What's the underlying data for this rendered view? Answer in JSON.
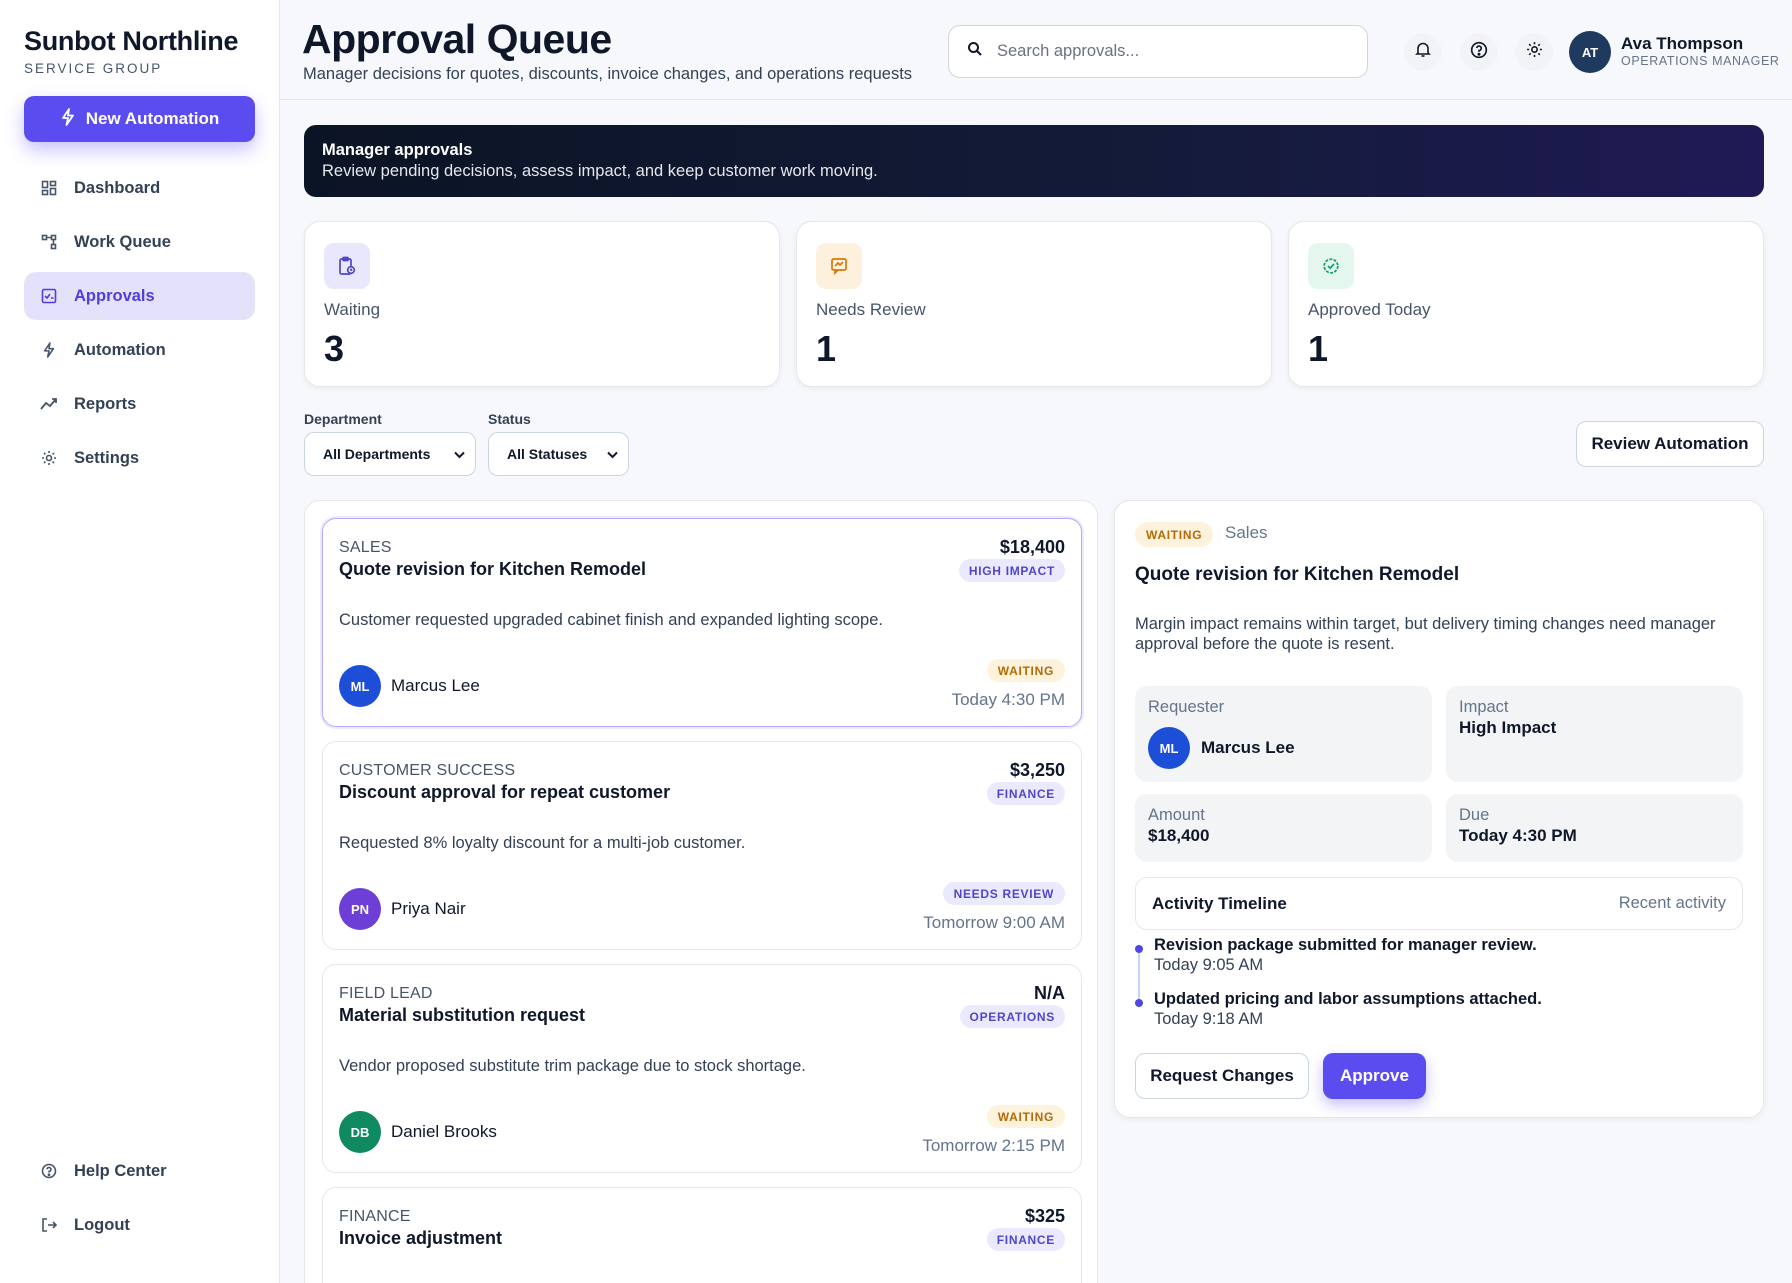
{
  "brand": {
    "name": "Sunbot Northline",
    "sub": "SERVICE GROUP"
  },
  "sidebar": {
    "new_automation": "New Automation",
    "items": [
      {
        "label": "Dashboard",
        "icon": "dashboard-icon"
      },
      {
        "label": "Work Queue",
        "icon": "work-queue-icon"
      },
      {
        "label": "Approvals",
        "icon": "approvals-icon",
        "active": true
      },
      {
        "label": "Automation",
        "icon": "bolt-icon"
      },
      {
        "label": "Reports",
        "icon": "trend-icon"
      },
      {
        "label": "Settings",
        "icon": "gear-icon"
      }
    ],
    "bottom": [
      {
        "label": "Help Center",
        "icon": "help-icon"
      },
      {
        "label": "Logout",
        "icon": "logout-icon"
      }
    ]
  },
  "header": {
    "title": "Approval Queue",
    "subtitle": "Manager decisions for quotes, discounts, invoice changes, and operations requests",
    "search_placeholder": "Search approvals...",
    "user": {
      "initials": "AT",
      "name": "Ava Thompson",
      "role": "OPERATIONS MANAGER"
    }
  },
  "banner": {
    "title": "Manager approvals",
    "text": "Review pending decisions, assess impact, and keep customer work moving."
  },
  "stats": [
    {
      "label": "Waiting",
      "value": "3"
    },
    {
      "label": "Needs Review",
      "value": "1"
    },
    {
      "label": "Approved Today",
      "value": "1"
    }
  ],
  "filters": {
    "department_label": "Department",
    "department_value": "All Departments",
    "status_label": "Status",
    "status_value": "All Statuses",
    "review_automation": "Review Automation"
  },
  "approvals": [
    {
      "dept": "SALES",
      "title": "Quote revision for Kitchen Remodel",
      "amount": "$18,400",
      "tag": "HIGH IMPACT",
      "desc": "Customer requested upgraded cabinet finish and expanded lighting scope.",
      "initials": "ML",
      "person": "Marcus Lee",
      "status": "WAITING",
      "time": "Today 4:30 PM"
    },
    {
      "dept": "CUSTOMER SUCCESS",
      "title": "Discount approval for repeat customer",
      "amount": "$3,250",
      "tag": "FINANCE",
      "desc": "Requested 8% loyalty discount for a multi-job customer.",
      "initials": "PN",
      "person": "Priya Nair",
      "status": "NEEDS REVIEW",
      "time": "Tomorrow 9:00 AM"
    },
    {
      "dept": "FIELD LEAD",
      "title": "Material substitution request",
      "amount": "N/A",
      "tag": "OPERATIONS",
      "desc": "Vendor proposed substitute trim package due to stock shortage.",
      "initials": "DB",
      "person": "Daniel Brooks",
      "status": "WAITING",
      "time": "Tomorrow 2:15 PM"
    },
    {
      "dept": "FINANCE",
      "title": "Invoice adjustment",
      "amount": "$325",
      "tag": "FINANCE"
    }
  ],
  "detail": {
    "status": "WAITING",
    "dept": "Sales",
    "title": "Quote revision for Kitchen Remodel",
    "desc": "Margin impact remains within target, but delivery timing changes need manager approval before the quote is resent.",
    "requester_label": "Requester",
    "requester_initials": "ML",
    "requester_name": "Marcus Lee",
    "impact_label": "Impact",
    "impact_value": "High Impact",
    "amount_label": "Amount",
    "amount_value": "$18,400",
    "due_label": "Due",
    "due_value": "Today 4:30 PM",
    "timeline_title": "Activity Timeline",
    "timeline_right": "Recent activity",
    "timeline": [
      {
        "text": "Revision package submitted for manager review.",
        "time": "Today 9:05 AM"
      },
      {
        "text": "Updated pricing and labor assumptions attached.",
        "time": "Today 9:18 AM"
      }
    ],
    "request_changes": "Request Changes",
    "approve": "Approve"
  }
}
